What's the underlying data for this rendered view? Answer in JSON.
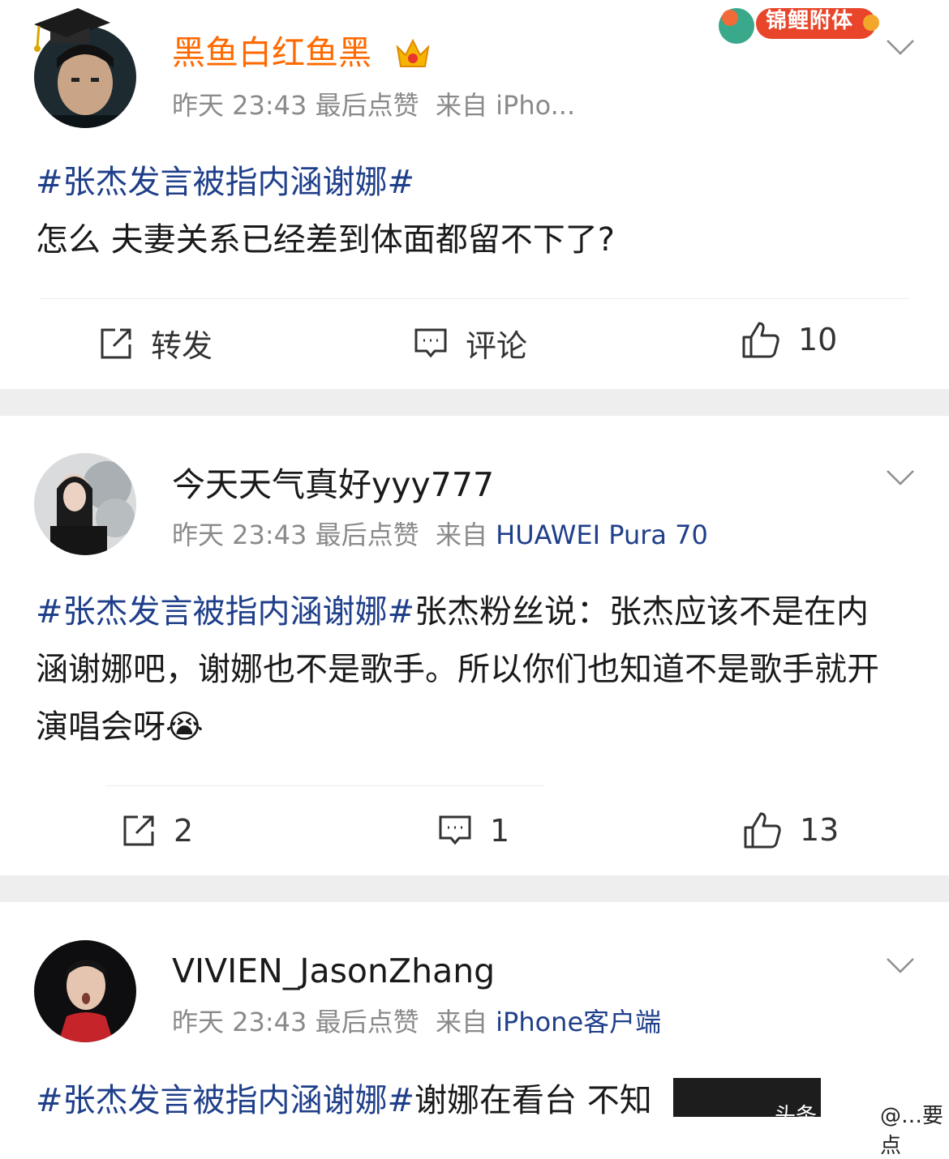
{
  "posts": [
    {
      "username": "黑鱼白红鱼黑",
      "time": "昨天 23:43",
      "last_like": "最后点赞",
      "source_prefix": "来自",
      "device": "iPho...",
      "hashtag": "#张杰发言被指内涵谢娜#",
      "text": "怎么 夫妻关系已经差到体面都留不下了?",
      "badge": "锦鲤附体",
      "actions": {
        "repost": "转发",
        "comment": "评论",
        "like": "10"
      }
    },
    {
      "username": "今天天气真好yyy777",
      "time": "昨天 23:43",
      "last_like": "最后点赞",
      "source_prefix": "来自",
      "device": "HUAWEI Pura 70",
      "hashtag": "#张杰发言被指内涵谢娜#",
      "text": "张杰粉丝说：张杰应该不是在内涵谢娜吧，谢娜也不是歌手。所以你们也知道不是歌手就开演唱会呀",
      "emoji": "😭",
      "actions": {
        "repost": "2",
        "comment": "1",
        "like": "13"
      }
    },
    {
      "username": "VIVIEN_JasonZhang",
      "time": "昨天 23:43",
      "last_like": "最后点赞",
      "source_prefix": "来自",
      "device": "iPhone客户端",
      "hashtag": "#张杰发言被指内涵谢娜#",
      "text": "谢娜在看台 不知"
    }
  ],
  "watermark": {
    "left": "头条",
    "right": "@…要点"
  },
  "colors": {
    "vip_name": "#ff6a00",
    "link": "#1f3f8a",
    "meta": "#8a8a8a",
    "separator": "#eeeeef"
  },
  "icons": [
    "crown-icon",
    "chevron-down-icon",
    "repost-icon",
    "comment-icon",
    "like-icon"
  ]
}
